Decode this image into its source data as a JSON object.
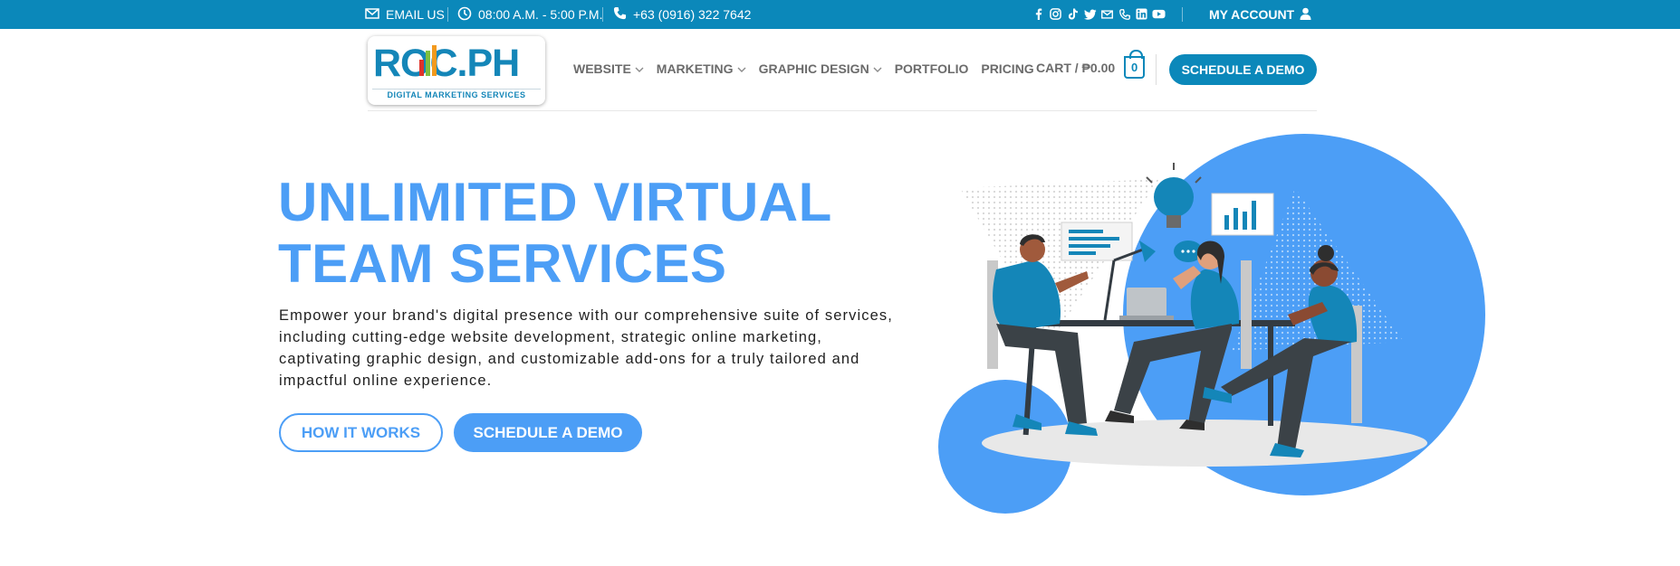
{
  "topbar": {
    "email": "EMAIL US",
    "hours": "08:00 A.M. - 5:00 P.M.",
    "phone": "+63 (0916) 322 7642",
    "account": "MY ACCOUNT",
    "social_icons": [
      "facebook-icon",
      "instagram-icon",
      "tiktok-icon",
      "twitter-icon",
      "email-icon",
      "phone-icon",
      "linkedin-icon",
      "youtube-icon"
    ]
  },
  "logo": {
    "main": "ROC.PH",
    "sub": "DIGITAL MARKETING SERVICES"
  },
  "nav": {
    "items": [
      {
        "label": "WEBSITE",
        "dropdown": true
      },
      {
        "label": "MARKETING",
        "dropdown": true
      },
      {
        "label": "GRAPHIC DESIGN",
        "dropdown": true
      },
      {
        "label": "PORTFOLIO",
        "dropdown": false
      },
      {
        "label": "PRICING",
        "dropdown": false
      }
    ],
    "cart_label": "CART / ₱0.00",
    "cart_count": "0",
    "demo_button": "SCHEDULE A DEMO"
  },
  "hero": {
    "title_line1": "UNLIMITED VIRTUAL",
    "title_line2": "TEAM SERVICES",
    "description": "Empower your brand's digital presence with our comprehensive suite of services, including cutting-edge website development, strategic online marketing, captivating graphic design, and customizable add-ons for a truly tailored and impactful online experience.",
    "how_button": "HOW IT WORKS",
    "demo_button": "SCHEDULE A DEMO"
  },
  "colors": {
    "topbar": "#0b88ba",
    "accent": "#4c9ef6",
    "brand": "#1486b8",
    "nav_text": "#6b6b6b"
  }
}
